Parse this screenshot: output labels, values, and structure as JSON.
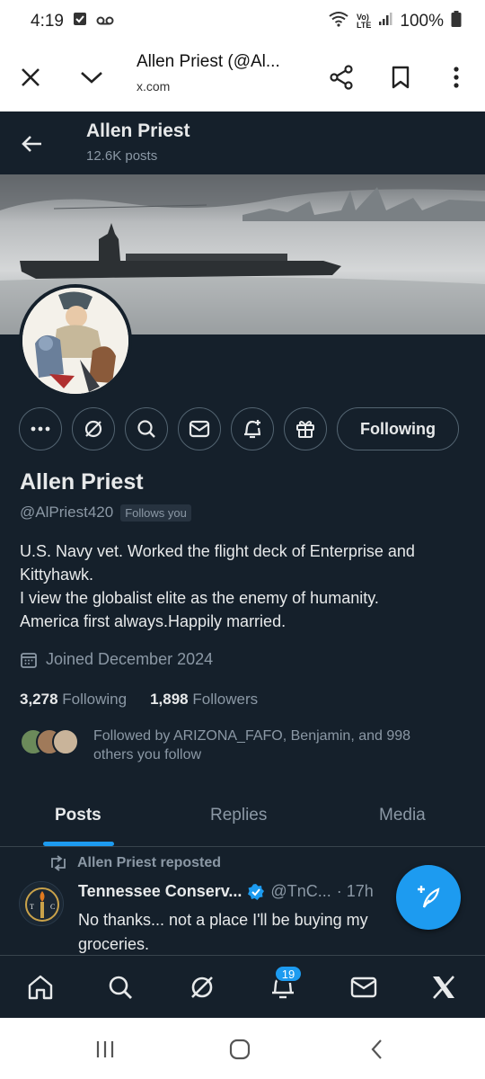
{
  "status_bar": {
    "time": "4:19",
    "battery": "100%"
  },
  "browser": {
    "title": "Allen Priest (@Al...",
    "url": "x.com"
  },
  "header": {
    "name": "Allen Priest",
    "posts_count": "12.6K posts"
  },
  "profile": {
    "name": "Allen Priest",
    "handle": "@AlPriest420",
    "follows_you": "Follows you",
    "bio_lines": [
      "U.S. Navy vet. Worked the flight deck of Enterprise and Kittyhawk.",
      "I view the globalist elite as the enemy of humanity.",
      "America first always.Happily married."
    ],
    "joined": "Joined December 2024",
    "following_count": "3,278",
    "following_label": "Following",
    "followers_count": "1,898",
    "followers_label": "Followers",
    "followed_by": "Followed by ARIZONA_FAFO, Benjamin, and 998 others you follow"
  },
  "actions": {
    "following_label": "Following"
  },
  "tabs": [
    {
      "label": "Posts",
      "active": true
    },
    {
      "label": "Replies",
      "active": false
    },
    {
      "label": "Media",
      "active": false
    }
  ],
  "tweet": {
    "repost_label": "Allen Priest reposted",
    "author_name": "Tennessee Conserv...",
    "author_handle": "@TnC...",
    "time": "· 17h",
    "text": "No thanks... not a place I'll be buying my groceries."
  },
  "bottom_nav": {
    "notification_count": "19"
  },
  "colors": {
    "background": "#15202b",
    "accent": "#1d9bf0",
    "muted": "#8b98a5"
  }
}
